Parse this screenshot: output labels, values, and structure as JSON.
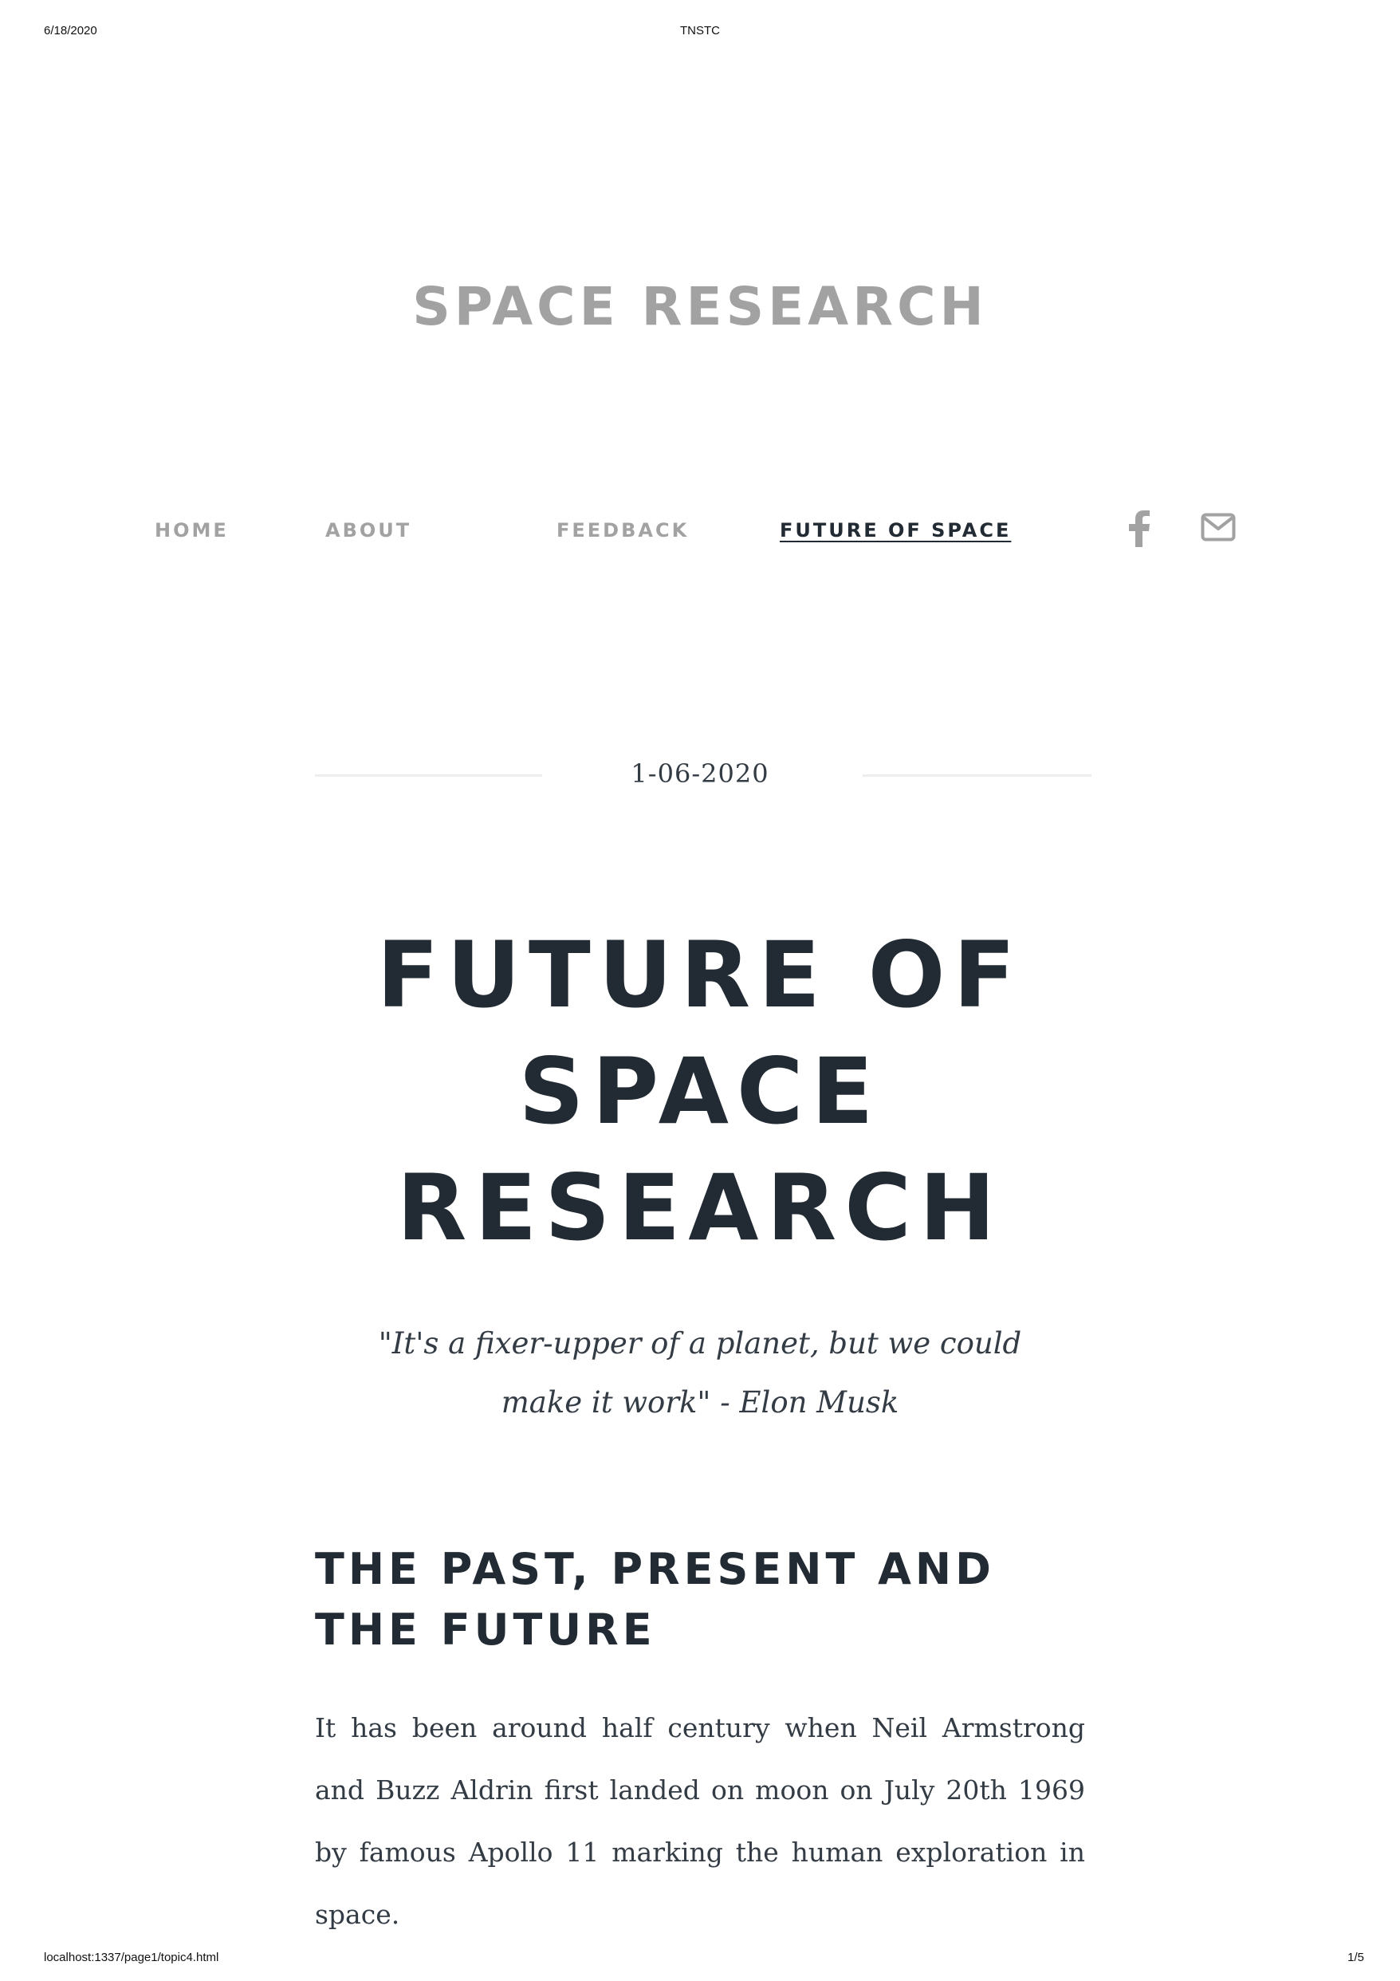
{
  "print_header": {
    "date": "6/18/2020",
    "title": "TNSTC"
  },
  "print_footer": {
    "url": "localhost:1337/page1/topic4.html",
    "page": "1/5"
  },
  "site": {
    "title": "SPACE RESEARCH"
  },
  "nav": {
    "items": [
      {
        "label": "HOME",
        "active": false
      },
      {
        "label": "ABOUT",
        "active": false
      },
      {
        "label": "FEEDBACK",
        "active": false
      },
      {
        "label": "FUTURE OF SPACE",
        "active": true
      }
    ],
    "icons": [
      "facebook-icon",
      "envelope-icon"
    ]
  },
  "post": {
    "date": "1-06-2020",
    "title": "FUTURE OF SPACE RESEARCH",
    "quote": "\"It's a fixer-upper of a planet, but we could make it work\" - Elon Musk",
    "section_heading": "THE PAST, PRESENT AND THE FUTURE",
    "paragraph": "It has been around half century when Neil Armstrong and Buzz Aldrin first landed on moon on July 20th 1969 by famous Apollo 11 marking the human exploration in space."
  },
  "colors": {
    "muted": "#a2a2a2",
    "text": "#222a33",
    "divider": "#eeeeee"
  }
}
